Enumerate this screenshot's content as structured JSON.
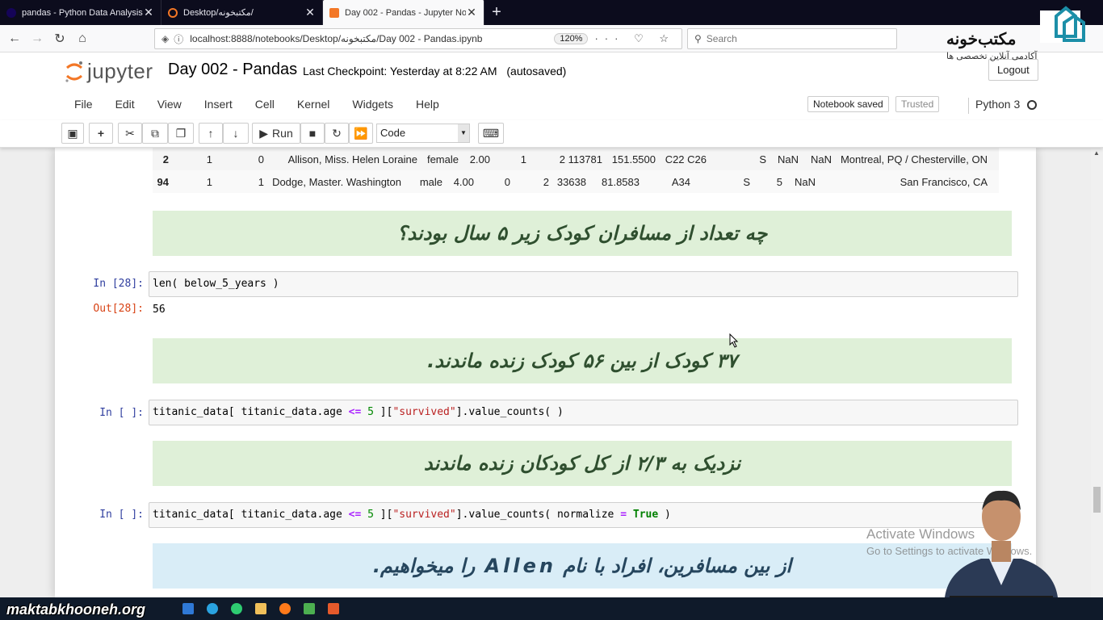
{
  "browser": {
    "tabs": [
      {
        "title": "pandas - Python Data Analysis",
        "active": false
      },
      {
        "title": "Desktop/مکتبخونه/",
        "active": false
      },
      {
        "title": "Day 002 - Pandas - Jupyter Note",
        "active": true
      }
    ],
    "new_tab": "+",
    "url": "localhost:8888/notebooks/Desktop/مکتبخونه/Day 002 - Pandas.ipynb",
    "zoom": "120%",
    "search_placeholder": "Search"
  },
  "jupyter": {
    "logo_text": "jupyter",
    "notebook_title": "Day 002 - Pandas",
    "checkpoint": "Last Checkpoint: Yesterday at 8:22 AM",
    "autosaved": "(autosaved)",
    "logout_label": "Logout",
    "menu": [
      "File",
      "Edit",
      "View",
      "Insert",
      "Cell",
      "Kernel",
      "Widgets",
      "Help"
    ],
    "notebook_saved": "Notebook saved",
    "trusted": "Trusted",
    "kernel_name": "Python 3",
    "run_label": "Run",
    "cell_type": "Code"
  },
  "brand": {
    "name": "مکتب‌خونه",
    "subtitle": "آکادمی آنلاین تخصصی ها",
    "site_watermark": "maktabkhooneh.org"
  },
  "dataframe_rows": [
    {
      "index": "2",
      "pclass": "1",
      "survived": "0",
      "name": "Allison, Miss. Helen Loraine",
      "sex": "female",
      "age": "2.00",
      "sibsp": "1",
      "parch": "2",
      "ticket": "113781",
      "fare": "151.5500",
      "cabin": "C22 C26",
      "embarked": "S",
      "boat": "NaN",
      "body": "NaN",
      "home_dest": "Montreal, PQ / Chesterville, ON"
    },
    {
      "index": "94",
      "pclass": "1",
      "survived": "1",
      "name": "Dodge, Master. Washington",
      "sex": "male",
      "age": "4.00",
      "sibsp": "0",
      "parch": "2",
      "ticket": "33638",
      "fare": "81.8583",
      "cabin": "A34",
      "embarked": "S",
      "boat": "5",
      "body": "NaN",
      "home_dest": "San Francisco, CA"
    }
  ],
  "cells": {
    "md1": "چه تعداد از مسافران کودک زیر ۵ سال بودند؟",
    "code1_prompt": "In [28]:",
    "code1": "len( below_5_years )",
    "out1_prompt": "Out[28]:",
    "out1": "56",
    "md2": "۳۷ کودک از بین ۵۶ کودک زنده ماندند.",
    "code2_prompt": "In [ ]:",
    "code2_a": "titanic_data[ titanic_data.age ",
    "code2_op": "<=",
    "code2_num": " 5",
    "code2_b": " ][",
    "code2_str": "\"survived\"",
    "code2_c": "].value_counts( )",
    "md3": "نزدیک به ۲/۳ از کل کودکان زنده ماندند",
    "code3_prompt": "In [ ]:",
    "code3_a": "titanic_data[ titanic_data.age ",
    "code3_op": "<=",
    "code3_num": " 5",
    "code3_b": " ][",
    "code3_str": "\"survived\"",
    "code3_c": "].value_counts( normalize ",
    "code3_eq": "=",
    "code3_true": " True",
    "code3_d": " )",
    "md4": "از بین مسافرین، افراد با نام Allen را میخواهیم."
  },
  "watermark": {
    "line1": "Activate Windows",
    "line2": "Go to Settings to activate Windows."
  },
  "colors": {
    "markdown_green": "#dff0d8",
    "markdown_blue": "#d9edf7",
    "in_prompt": "#303f9f",
    "out_prompt": "#d84315",
    "jupyter_orange": "#f37726"
  }
}
